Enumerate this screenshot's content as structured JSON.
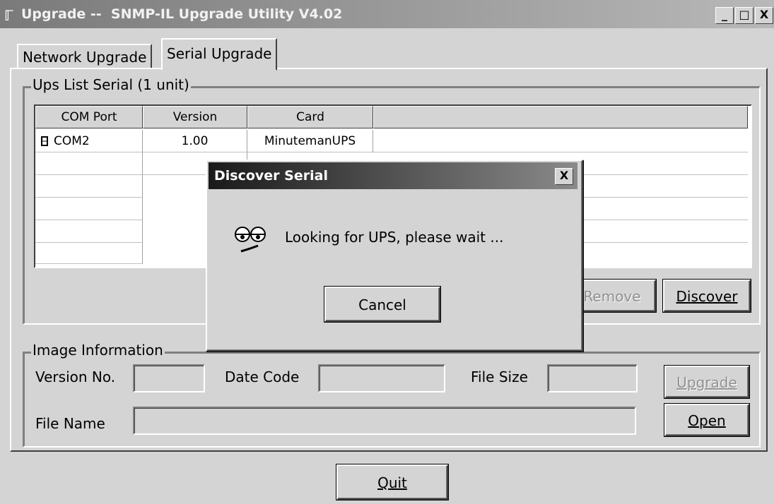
{
  "window": {
    "title": "Upgrade --  SNMP-IL Upgrade Utility V4.02",
    "minimize": "_",
    "maximize": "□",
    "close": "X"
  },
  "tabs": [
    {
      "label": "Network Upgrade",
      "active": false
    },
    {
      "label": "Serial Upgrade",
      "active": true
    }
  ],
  "ups_list": {
    "group_label": "Ups List Serial (1 unit)",
    "columns": [
      "COM Port",
      "Version",
      "Card",
      ""
    ],
    "rows": [
      {
        "port": "COM2",
        "version": "1.00",
        "card": "MinutemanUPS"
      }
    ],
    "remove_label": "Remove",
    "discover_label": "Discover"
  },
  "image_info": {
    "group_label": "Image Information",
    "version_label": "Version No.",
    "version_value": "",
    "date_label": "Date Code",
    "date_value": "",
    "size_label": "File Size",
    "size_value": "",
    "filename_label": "File Name",
    "filename_value": "",
    "upgrade_label": "Upgrade",
    "open_label": "Open"
  },
  "quit_label": "Quit",
  "dialog": {
    "title": "Discover Serial",
    "close": "X",
    "message": "Looking for UPS, please wait ...",
    "cancel_label": "Cancel"
  }
}
